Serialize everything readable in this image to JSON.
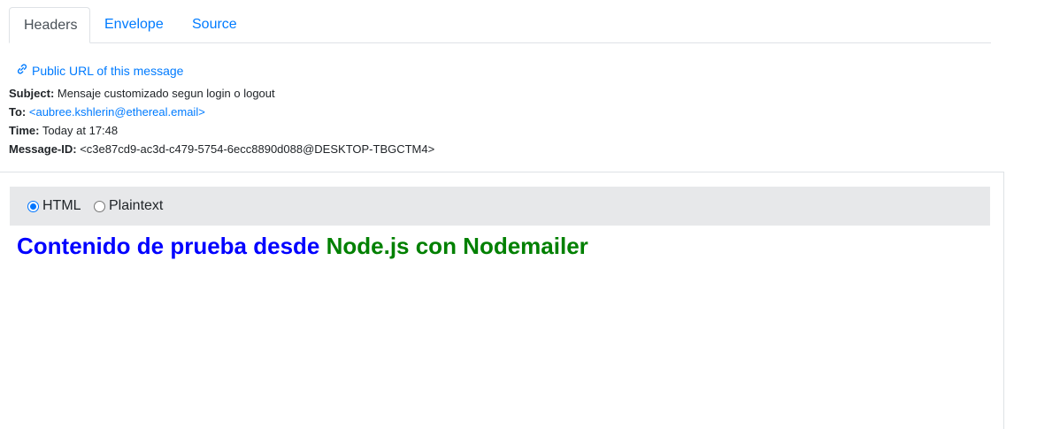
{
  "tabs": {
    "headers": "Headers",
    "envelope": "Envelope",
    "source": "Source",
    "active": "Headers"
  },
  "public_url": {
    "label": "Public URL of this message",
    "icon": "link-icon"
  },
  "headers": {
    "subject_label": "Subject:",
    "subject_value": "Mensaje customizado segun login o logout",
    "to_label": "To:",
    "to_value": "<aubree.kshlerin@ethereal.email>",
    "time_label": "Time:",
    "time_value": "Today at 17:48",
    "message_id_label": "Message-ID:",
    "message_id_value": "<c3e87cd9-ac3d-c479-5754-6ecc8890d088@DESKTOP-TBGCTM4>"
  },
  "format_options": {
    "html_label": "HTML",
    "plaintext_label": "Plaintext",
    "selected": "HTML"
  },
  "message": {
    "part1": "Contenido de prueba desde ",
    "part2": "Node.js con Nodemailer",
    "color1": "#0000ff",
    "color2": "#008000"
  },
  "colors": {
    "link": "#007bff",
    "format_bar_bg": "#e7e8ea"
  }
}
